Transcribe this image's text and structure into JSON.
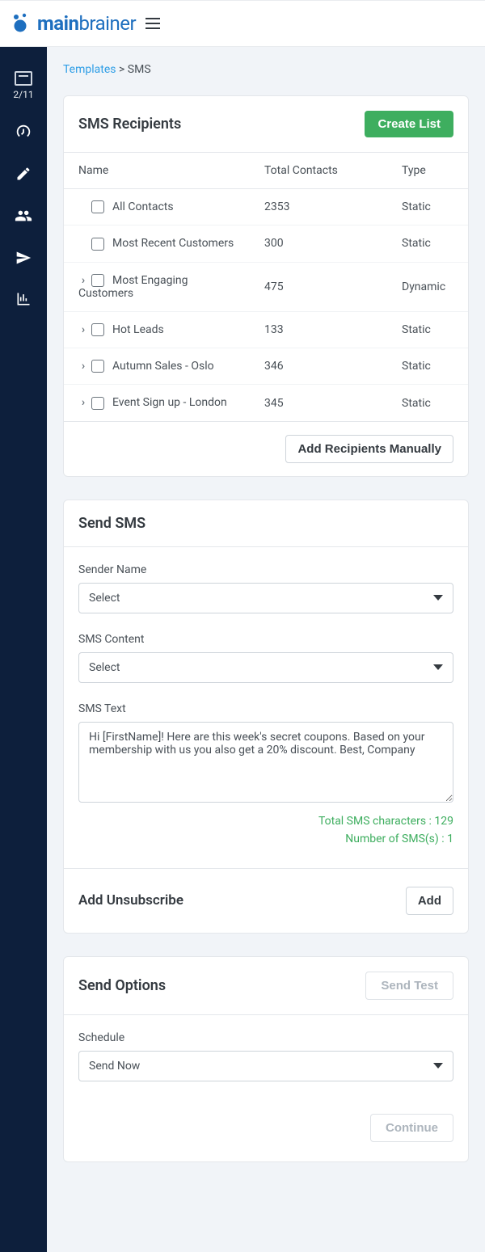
{
  "header": {
    "logo_main": "main",
    "logo_sub": "brainer"
  },
  "nav": {
    "progress": "2/11"
  },
  "breadcrumb": {
    "link": "Templates",
    "sep": " > ",
    "current": "SMS"
  },
  "recipients": {
    "title": "SMS Recipients",
    "create_btn": "Create List",
    "columns": {
      "name": "Name",
      "total": "Total Contacts",
      "type": "Type"
    },
    "rows": [
      {
        "expandable": false,
        "name": "All Contacts",
        "total": "2353",
        "type": "Static"
      },
      {
        "expandable": false,
        "name": "Most Recent Customers",
        "total": "300",
        "type": "Static"
      },
      {
        "expandable": true,
        "name": "Most Engaging Customers",
        "total": "475",
        "type": "Dynamic"
      },
      {
        "expandable": true,
        "name": "Hot Leads",
        "total": "133",
        "type": "Static"
      },
      {
        "expandable": true,
        "name": "Autumn Sales - Oslo",
        "total": "346",
        "type": "Static"
      },
      {
        "expandable": true,
        "name": "Event Sign up - London",
        "total": "345",
        "type": "Static"
      }
    ],
    "add_manual_btn": "Add Recipients Manually"
  },
  "send_sms": {
    "title": "Send SMS",
    "sender_label": "Sender Name",
    "sender_value": "Select",
    "content_label": "SMS Content",
    "content_value": "Select",
    "text_label": "SMS Text",
    "text_value": "Hi [FirstName]! Here are this week's secret coupons. Based on your membership with us you also get a 20% discount. Best, Company",
    "chars_label": "Total SMS characters : ",
    "chars_value": "129",
    "count_label": "Number of SMS(s) : ",
    "count_value": "1",
    "unsub_title": "Add Unsubscribe",
    "unsub_btn": "Add"
  },
  "send_options": {
    "title": "Send Options",
    "send_test_btn": "Send Test",
    "schedule_label": "Schedule",
    "schedule_value": "Send Now",
    "continue_btn": "Continue"
  }
}
